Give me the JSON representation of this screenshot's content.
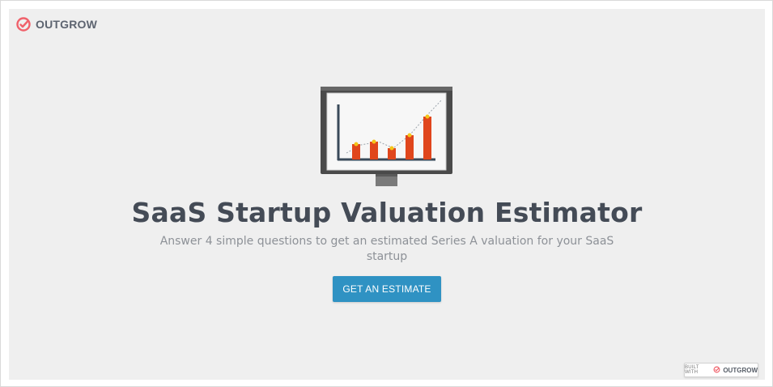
{
  "logo": {
    "text": "OUTGROW",
    "icon": "outgrow-logo-icon",
    "accent_color": "#f0616b"
  },
  "hero": {
    "icon": "bar-chart-monitor-icon",
    "title": "SaaS Startup Valuation Estimator",
    "subtitle": "Answer 4 simple questions to get an estimated Series A valuation for your SaaS startup"
  },
  "cta": {
    "label": "GET AN ESTIMATE",
    "color": "#2f92c3"
  },
  "badge": {
    "prefix": "BUILT WITH",
    "brand": "OUTGROW"
  },
  "colors": {
    "panel_bg": "#efefef",
    "title": "#444b56",
    "subtitle": "#8d9197",
    "bar": "#e0461c",
    "bar_dot": "#f5c518"
  }
}
